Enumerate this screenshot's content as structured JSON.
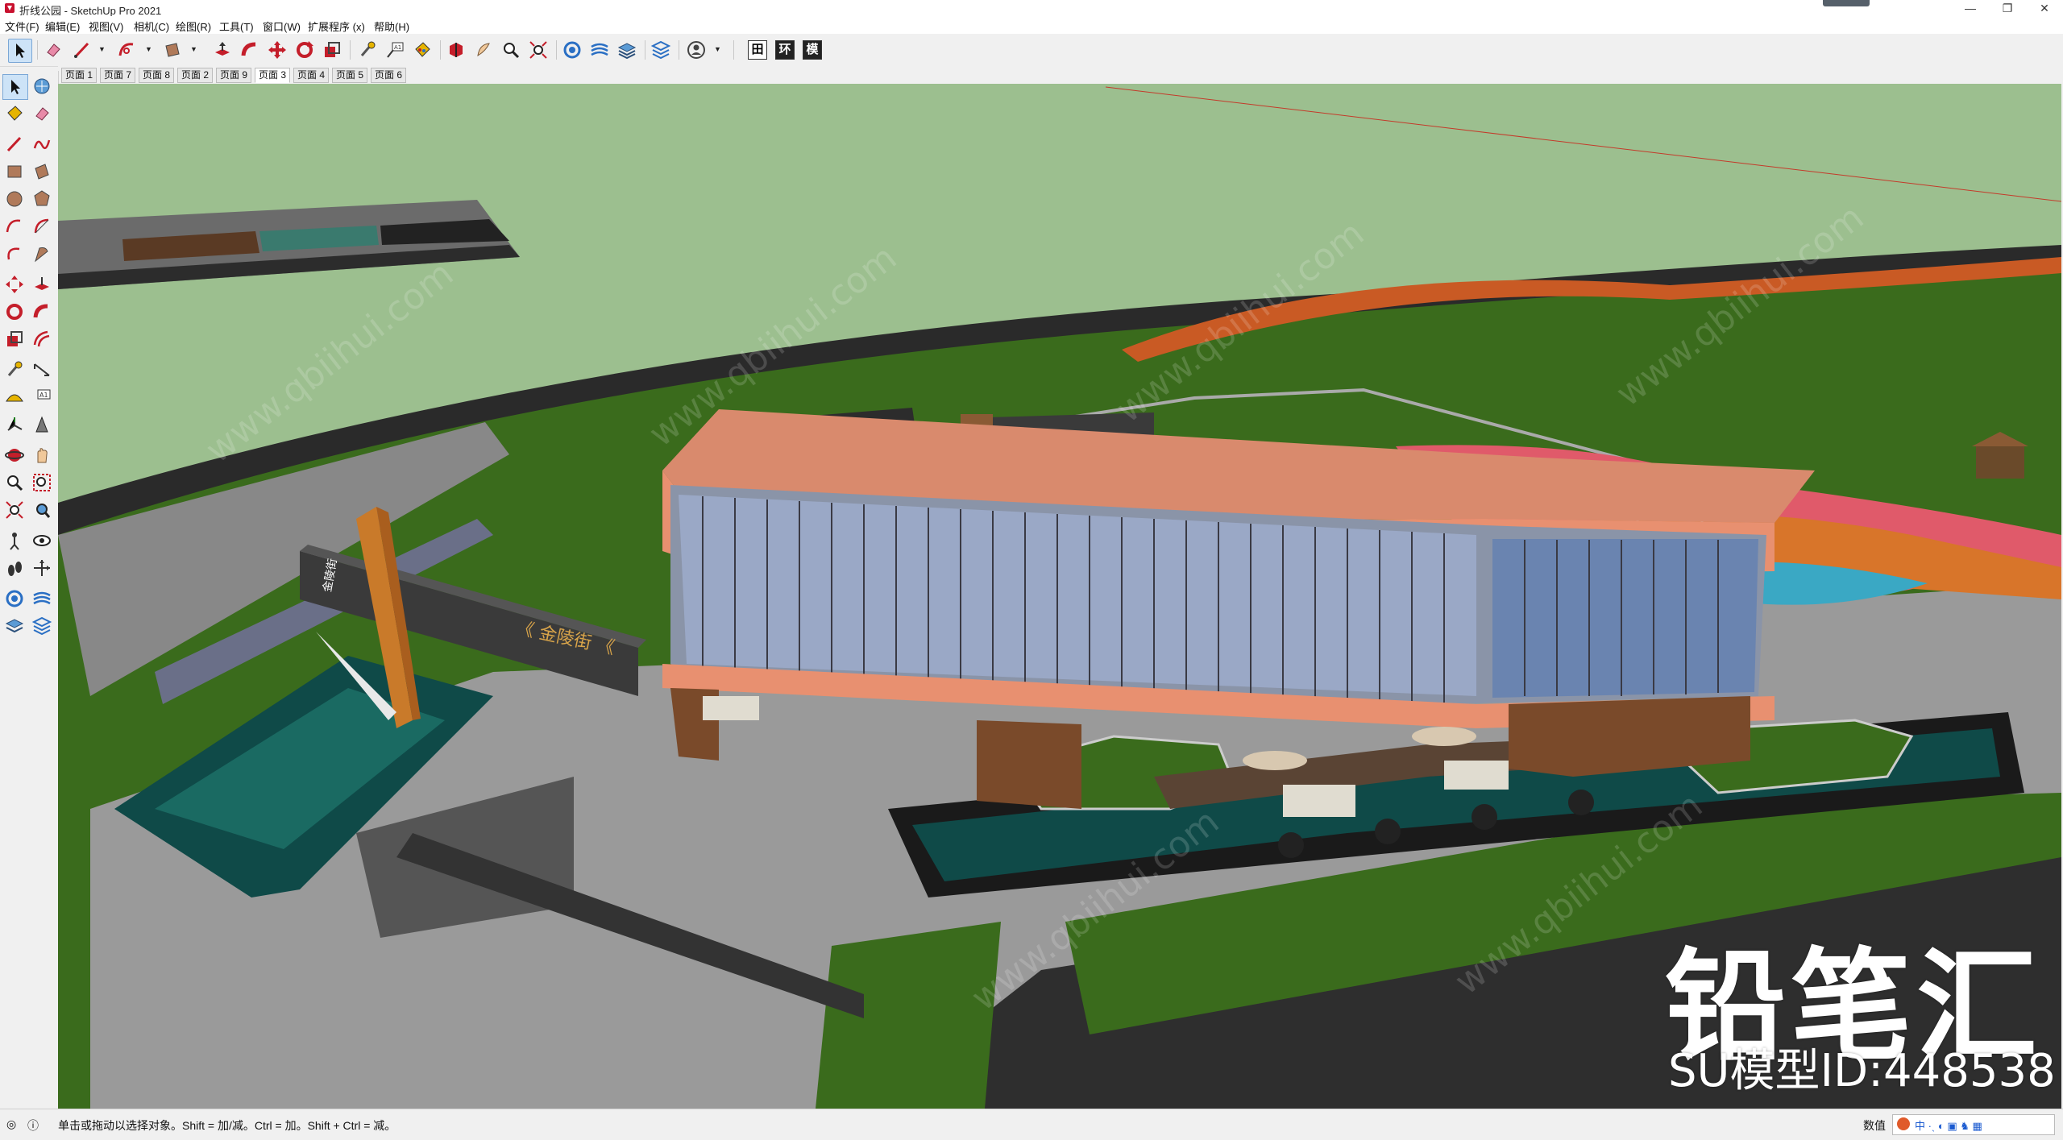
{
  "window": {
    "title": "折线公园 - SketchUp Pro 2021",
    "controls": [
      "minimize-icon",
      "restore-icon",
      "close-icon"
    ]
  },
  "menu": [
    {
      "label": "文件(F)"
    },
    {
      "label": "编辑(E)"
    },
    {
      "label": "视图(V)"
    },
    {
      "label": "相机(C)"
    },
    {
      "label": "绘图(R)"
    },
    {
      "label": "工具(T)"
    },
    {
      "label": "窗口(W)"
    },
    {
      "label": "扩展程序 (x)"
    },
    {
      "label": "帮助(H)"
    }
  ],
  "toolbar": {
    "icons": [
      "select-icon",
      "eraser-icon",
      "line-icon",
      "arc-icon",
      "rectangle-icon",
      "push-pull-icon",
      "follow-me-icon",
      "move-icon",
      "rotate-icon",
      "scale-icon",
      "tape-measure-icon",
      "text-icon",
      "paint-bucket-icon",
      "section-plane-icon",
      "walk-icon",
      "zoom-icon",
      "zoom-extents-icon",
      "geo-location-icon",
      "sandbox-icon",
      "layers-icon",
      "solid-tools-icon",
      "account-icon"
    ],
    "extension_buttons": [
      "田",
      "环",
      "模"
    ]
  },
  "scene_tabs": [
    {
      "label": "页面 1"
    },
    {
      "label": "页面 7"
    },
    {
      "label": "页面 8"
    },
    {
      "label": "页面 2"
    },
    {
      "label": "页面 9"
    },
    {
      "label": "页面 3",
      "active": true
    },
    {
      "label": "页面 4"
    },
    {
      "label": "页面 5"
    },
    {
      "label": "页面 6"
    }
  ],
  "left_tools": [
    "select-icon",
    "component-icon",
    "paint-bucket-icon",
    "eraser-icon",
    "line-icon",
    "freehand-icon",
    "rectangle-icon",
    "rotated-rect-icon",
    "circle-icon",
    "polygon-icon",
    "arc-icon",
    "pie-icon",
    "three-point-arc-icon",
    "two-point-arc-icon",
    "move-icon",
    "push-pull-icon",
    "rotate-icon",
    "follow-me-icon",
    "scale-icon",
    "offset-icon",
    "tape-measure-icon",
    "dimension-icon",
    "protractor-icon",
    "text-icon",
    "axes-icon",
    "3d-text-icon",
    "orbit-icon",
    "pan-icon",
    "zoom-icon",
    "zoom-window-icon",
    "zoom-extents-icon",
    "previous-icon",
    "position-camera-icon",
    "look-around-icon",
    "walk-icon",
    "section-icon",
    "sandbox-icon",
    "terrain-icon",
    "layers-icon",
    "tags-icon"
  ],
  "scene": {
    "signage_text": "金陵街",
    "wall_sign_text": "《 金陵街 《"
  },
  "watermarks": {
    "brand": "铅笔汇",
    "model_id": "SU模型ID:448538",
    "diagonal": "www.qbiihui.com"
  },
  "status": {
    "message": "单击或拖动以选择对象。Shift = 加/减。Ctrl = 加。Shift + Ctrl = 减。",
    "value_label": "数值",
    "value": ""
  },
  "colors": {
    "sky": "#9cbf8f",
    "grass": "#3a6b1c",
    "paving": "#9a9a9a",
    "roof": "#d98a6d",
    "water": "#0f4a48"
  }
}
